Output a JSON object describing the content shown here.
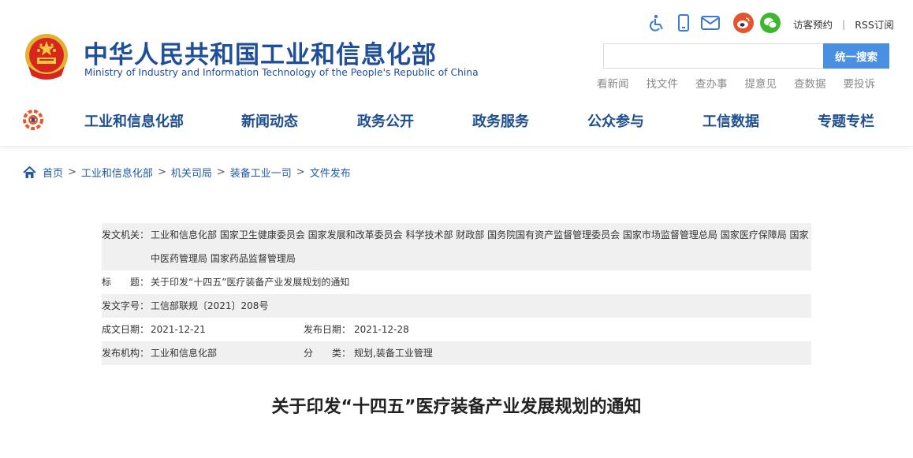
{
  "header": {
    "title_cn": "中华人民共和国工业和信息化部",
    "title_en": "Ministry of Industry and Information Technology of the People's Republic of China",
    "emblem_icon": "national-emblem-icon",
    "top_links": [
      "访客预约",
      "RSS订阅"
    ],
    "top_link_separator": "|",
    "top_icons": [
      "accessibility-icon",
      "mobile-phone-icon",
      "mail-icon",
      "weibo-icon",
      "wechat-icon"
    ],
    "search": {
      "value": "",
      "placeholder": "",
      "button_label": "统一搜索"
    },
    "quick_links": [
      "看新闻",
      "找文件",
      "查办事",
      "提意见",
      "查数据",
      "要投诉"
    ]
  },
  "nav": {
    "logo_icon": "miit-logo-icon",
    "items": [
      "工业和信息化部",
      "新闻动态",
      "政务公开",
      "政务服务",
      "公众参与",
      "工信数据",
      "专题专栏"
    ]
  },
  "breadcrumb": {
    "items": [
      "首页",
      "工业和信息化部",
      "机关司局",
      "装备工业一司",
      "文件发布"
    ],
    "separator": ">"
  },
  "doc_info": {
    "issuer_label": "发文机关：",
    "issuer": "工业和信息化部 国家卫生健康委员会 国家发展和改革委员会 科学技术部 财政部 国务院国有资产监督管理委员会 国家市场监督管理总局 国家医疗保障局 国家中医药管理局 国家药品监督管理局",
    "title_label": "标　　题：",
    "title": "关于印发“十四五”医疗装备产业发展规划的通知",
    "doc_number_label": "发文字号：",
    "doc_number": "工信部联规〔2021〕208号",
    "created_label": "成文日期：",
    "created": "2021-12-21",
    "published_label": "发布日期：",
    "published": "2021-12-28",
    "agency_label": "发布机构：",
    "agency": "工业和信息化部",
    "category_label": "分　　类：",
    "category": "规划,装备工业管理"
  },
  "article": {
    "title": "关于印发“十四五”医疗装备产业发展规划的通知"
  },
  "colors": {
    "brand_blue": "#1f4e9a",
    "search_button": "#4a90e2",
    "link_blue": "#1f5aa6",
    "row_shade": "#f0f0f0",
    "weibo_red": "#e6532f",
    "wechat_green": "#3fb62f"
  }
}
